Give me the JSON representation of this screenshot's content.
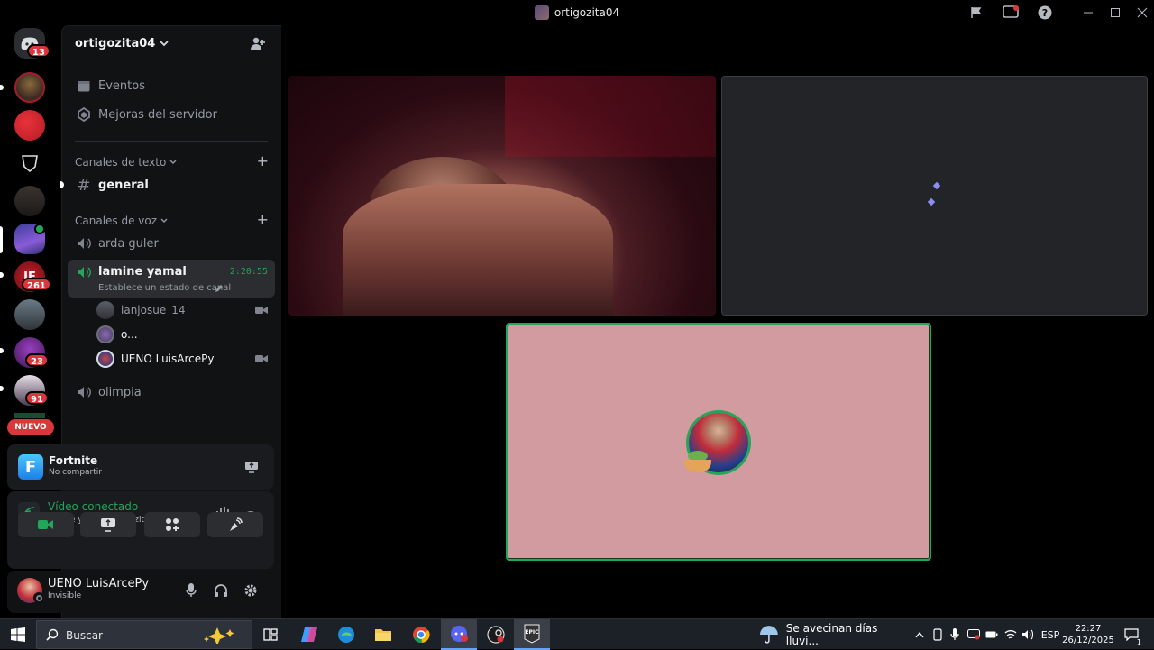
{
  "window": {
    "title": "ortigozita04"
  },
  "rail": {
    "badges": [
      "13",
      "261",
      "23",
      "91"
    ],
    "new_label": "NUEVO"
  },
  "sidebar": {
    "server_name": "ortigozita04",
    "events_label": "Eventos",
    "boosts_label": "Mejoras del servidor",
    "text_category": "Canales de texto",
    "text_channels": [
      "general"
    ],
    "voice_category": "Canales de voz",
    "voice_channels": [
      {
        "name": "arda guler"
      },
      {
        "name": "lamine yamal",
        "timer": "2:20:55",
        "status": "Establece un estado de canal"
      },
      {
        "name": "olimpia"
      }
    ],
    "members": [
      {
        "name": "ianjosue_14"
      },
      {
        "name": "o..."
      },
      {
        "name": "UENO LuisArcePy"
      }
    ]
  },
  "activity": {
    "game": "Fortnite",
    "sub": "No compartir"
  },
  "voice": {
    "status": "Vídeo conectado",
    "location": "lamine yamal / ortigozita04"
  },
  "user": {
    "name": "UENO LuisArcePy",
    "status": "Invisible"
  },
  "taskbar": {
    "search_placeholder": "Buscar",
    "weather_text": "Se avecinan días lluvi...",
    "lang": "ESP",
    "time": "22:27",
    "date": "26/12/2025",
    "notif_count": "1"
  },
  "colors": {
    "accent": "#5865f2",
    "online": "#23a55a",
    "danger": "#da373c",
    "pink_tile": "#d29b9f"
  }
}
